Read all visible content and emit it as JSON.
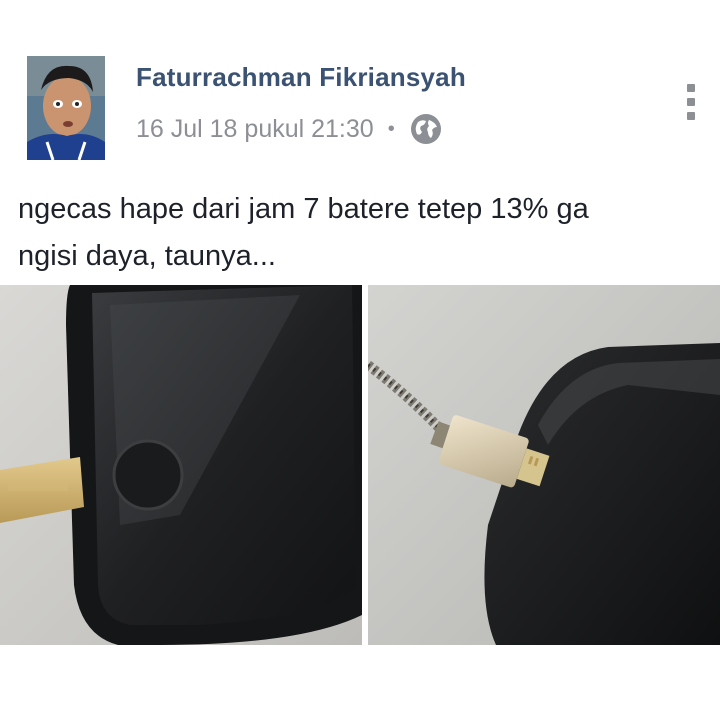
{
  "post": {
    "author_name": "Faturrachman Fikriansyah",
    "timestamp": "16 Jul 18 pukul 21:30",
    "separator": "•",
    "privacy_icon": "globe-icon",
    "menu_icon": "more-options-icon",
    "text_line1": "ngecas hape dari jam 7 batere tetep 13% ga",
    "text_line2": "ngisi daya, taunya..."
  },
  "colors": {
    "author": "#3b5272",
    "meta": "#8c8f94",
    "text": "#1d2129"
  }
}
